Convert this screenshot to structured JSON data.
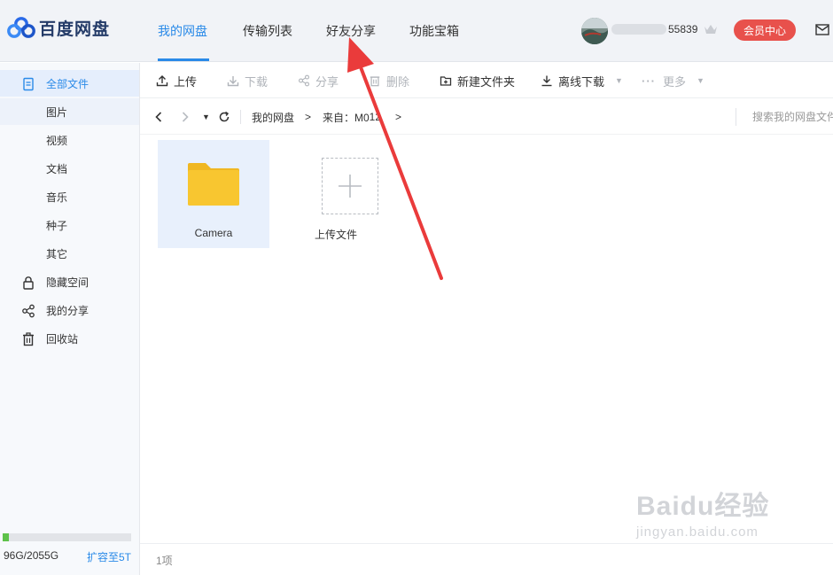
{
  "app": {
    "logo_text": "百度网盘"
  },
  "nav": {
    "tabs": [
      {
        "label": "我的网盘",
        "active": true
      },
      {
        "label": "传输列表",
        "active": false
      },
      {
        "label": "好友分享",
        "active": false
      },
      {
        "label": "功能宝箱",
        "active": false
      }
    ]
  },
  "user": {
    "name_suffix": "55839",
    "vip_button": "会员中心"
  },
  "sidebar": {
    "items": [
      {
        "label": "全部文件",
        "icon": "document-icon",
        "active": true
      },
      {
        "label": "图片",
        "selected": true
      },
      {
        "label": "视频"
      },
      {
        "label": "文档"
      },
      {
        "label": "音乐"
      },
      {
        "label": "种子"
      },
      {
        "label": "其它"
      },
      {
        "label": "隐藏空间",
        "icon": "lock-icon"
      },
      {
        "label": "我的分享",
        "icon": "share-icon"
      },
      {
        "label": "回收站",
        "icon": "trash-icon"
      }
    ],
    "quota": {
      "text": "96G/2055G",
      "used_fraction": 0.047,
      "expand_link": "扩容至5T"
    }
  },
  "toolbar": {
    "upload": "上传",
    "download": "下载",
    "share": "分享",
    "delete": "删除",
    "new_folder": "新建文件夹",
    "offline_download": "离线下载",
    "more": "更多"
  },
  "path": {
    "root": "我的网盘",
    "separator": ">",
    "current": "来自：M0",
    "current_hidden_tail": "12",
    "search_placeholder": "搜索我的网盘文件"
  },
  "files": [
    {
      "name": "Camera",
      "type": "folder",
      "selected": true
    },
    {
      "name": "上传文件",
      "type": "upload"
    }
  ],
  "footer": {
    "count": "1项"
  },
  "watermark": {
    "big": "Baidu经验",
    "small": "jingyan.baidu.com"
  },
  "colors": {
    "accent": "#2a8ae8",
    "vip": "#e8514c",
    "folder": "#f8c630",
    "arrow": "#ea3b3b",
    "quota": "#5ec24a"
  }
}
